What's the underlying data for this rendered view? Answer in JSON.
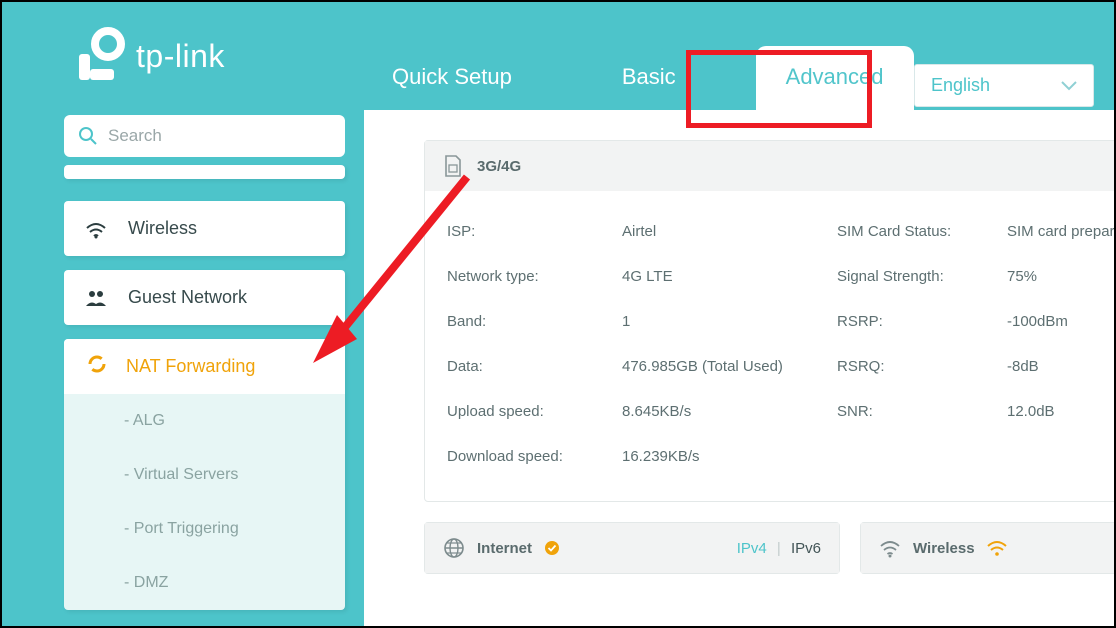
{
  "brand": "tp-link",
  "tabs": {
    "quick": "Quick Setup",
    "basic": "Basic",
    "advanced": "Advanced"
  },
  "lang": {
    "value": "English"
  },
  "search": {
    "placeholder": "Search"
  },
  "sidebar": {
    "wireless": "Wireless",
    "guest": "Guest Network",
    "nat": "NAT Forwarding",
    "subs": [
      "- ALG",
      "- Virtual Servers",
      "- Port Triggering",
      "- DMZ"
    ]
  },
  "panel34": {
    "title": "3G/4G",
    "rows": {
      "isp_l": "ISP:",
      "isp_v": "Airtel",
      "sim_l": "SIM Card Status:",
      "sim_v": "SIM card prepar",
      "net_l": "Network type:",
      "net_v": "4G LTE",
      "sig_l": "Signal Strength:",
      "sig_v": "75%",
      "band_l": "Band:",
      "band_v": "1",
      "rsrp_l": "RSRP:",
      "rsrp_v": "-100dBm",
      "data_l": "Data:",
      "data_v": "476.985GB (Total Used)",
      "rsrq_l": "RSRQ:",
      "rsrq_v": "-8dB",
      "up_l": "Upload speed:",
      "up_v": "8.645KB/s",
      "snr_l": "SNR:",
      "snr_v": "12.0dB",
      "down_l": "Download speed:",
      "down_v": "16.239KB/s"
    }
  },
  "internet": {
    "title": "Internet",
    "ipv4": "IPv4",
    "ipv6": "IPv6"
  },
  "wireless_card": {
    "title": "Wireless"
  }
}
